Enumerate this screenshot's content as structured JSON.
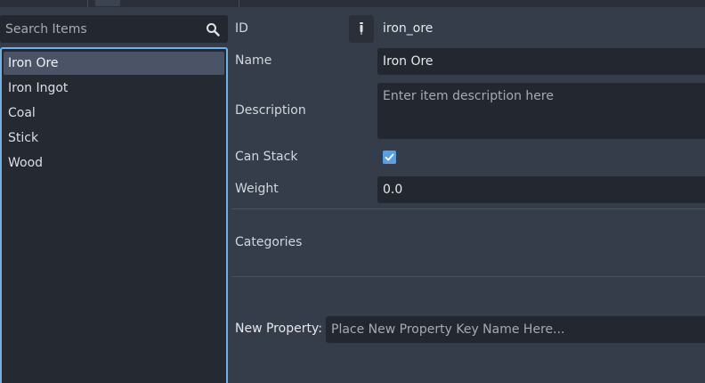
{
  "search": {
    "placeholder": "Search Items",
    "icon": "search-icon"
  },
  "items": [
    {
      "label": "Iron Ore",
      "selected": true
    },
    {
      "label": "Iron Ingot",
      "selected": false
    },
    {
      "label": "Coal",
      "selected": false
    },
    {
      "label": "Stick",
      "selected": false
    },
    {
      "label": "Wood",
      "selected": false
    }
  ],
  "properties": {
    "id": {
      "label": "ID",
      "value": "iron_ore",
      "icon": "pin-icon"
    },
    "name": {
      "label": "Name",
      "value": "Iron Ore"
    },
    "description": {
      "label": "Description",
      "placeholder": "Enter item description here"
    },
    "can_stack": {
      "label": "Can Stack",
      "checked": true
    },
    "weight": {
      "label": "Weight",
      "value": "0.0"
    },
    "categories": {
      "label": "Categories"
    }
  },
  "new_property": {
    "label": "New Property:",
    "placeholder": "Place New Property Key Name Here..."
  },
  "colors": {
    "background": "#363d4a",
    "field": "#232830",
    "accent": "#6fb2e8",
    "selected_row": "#4a5466"
  }
}
